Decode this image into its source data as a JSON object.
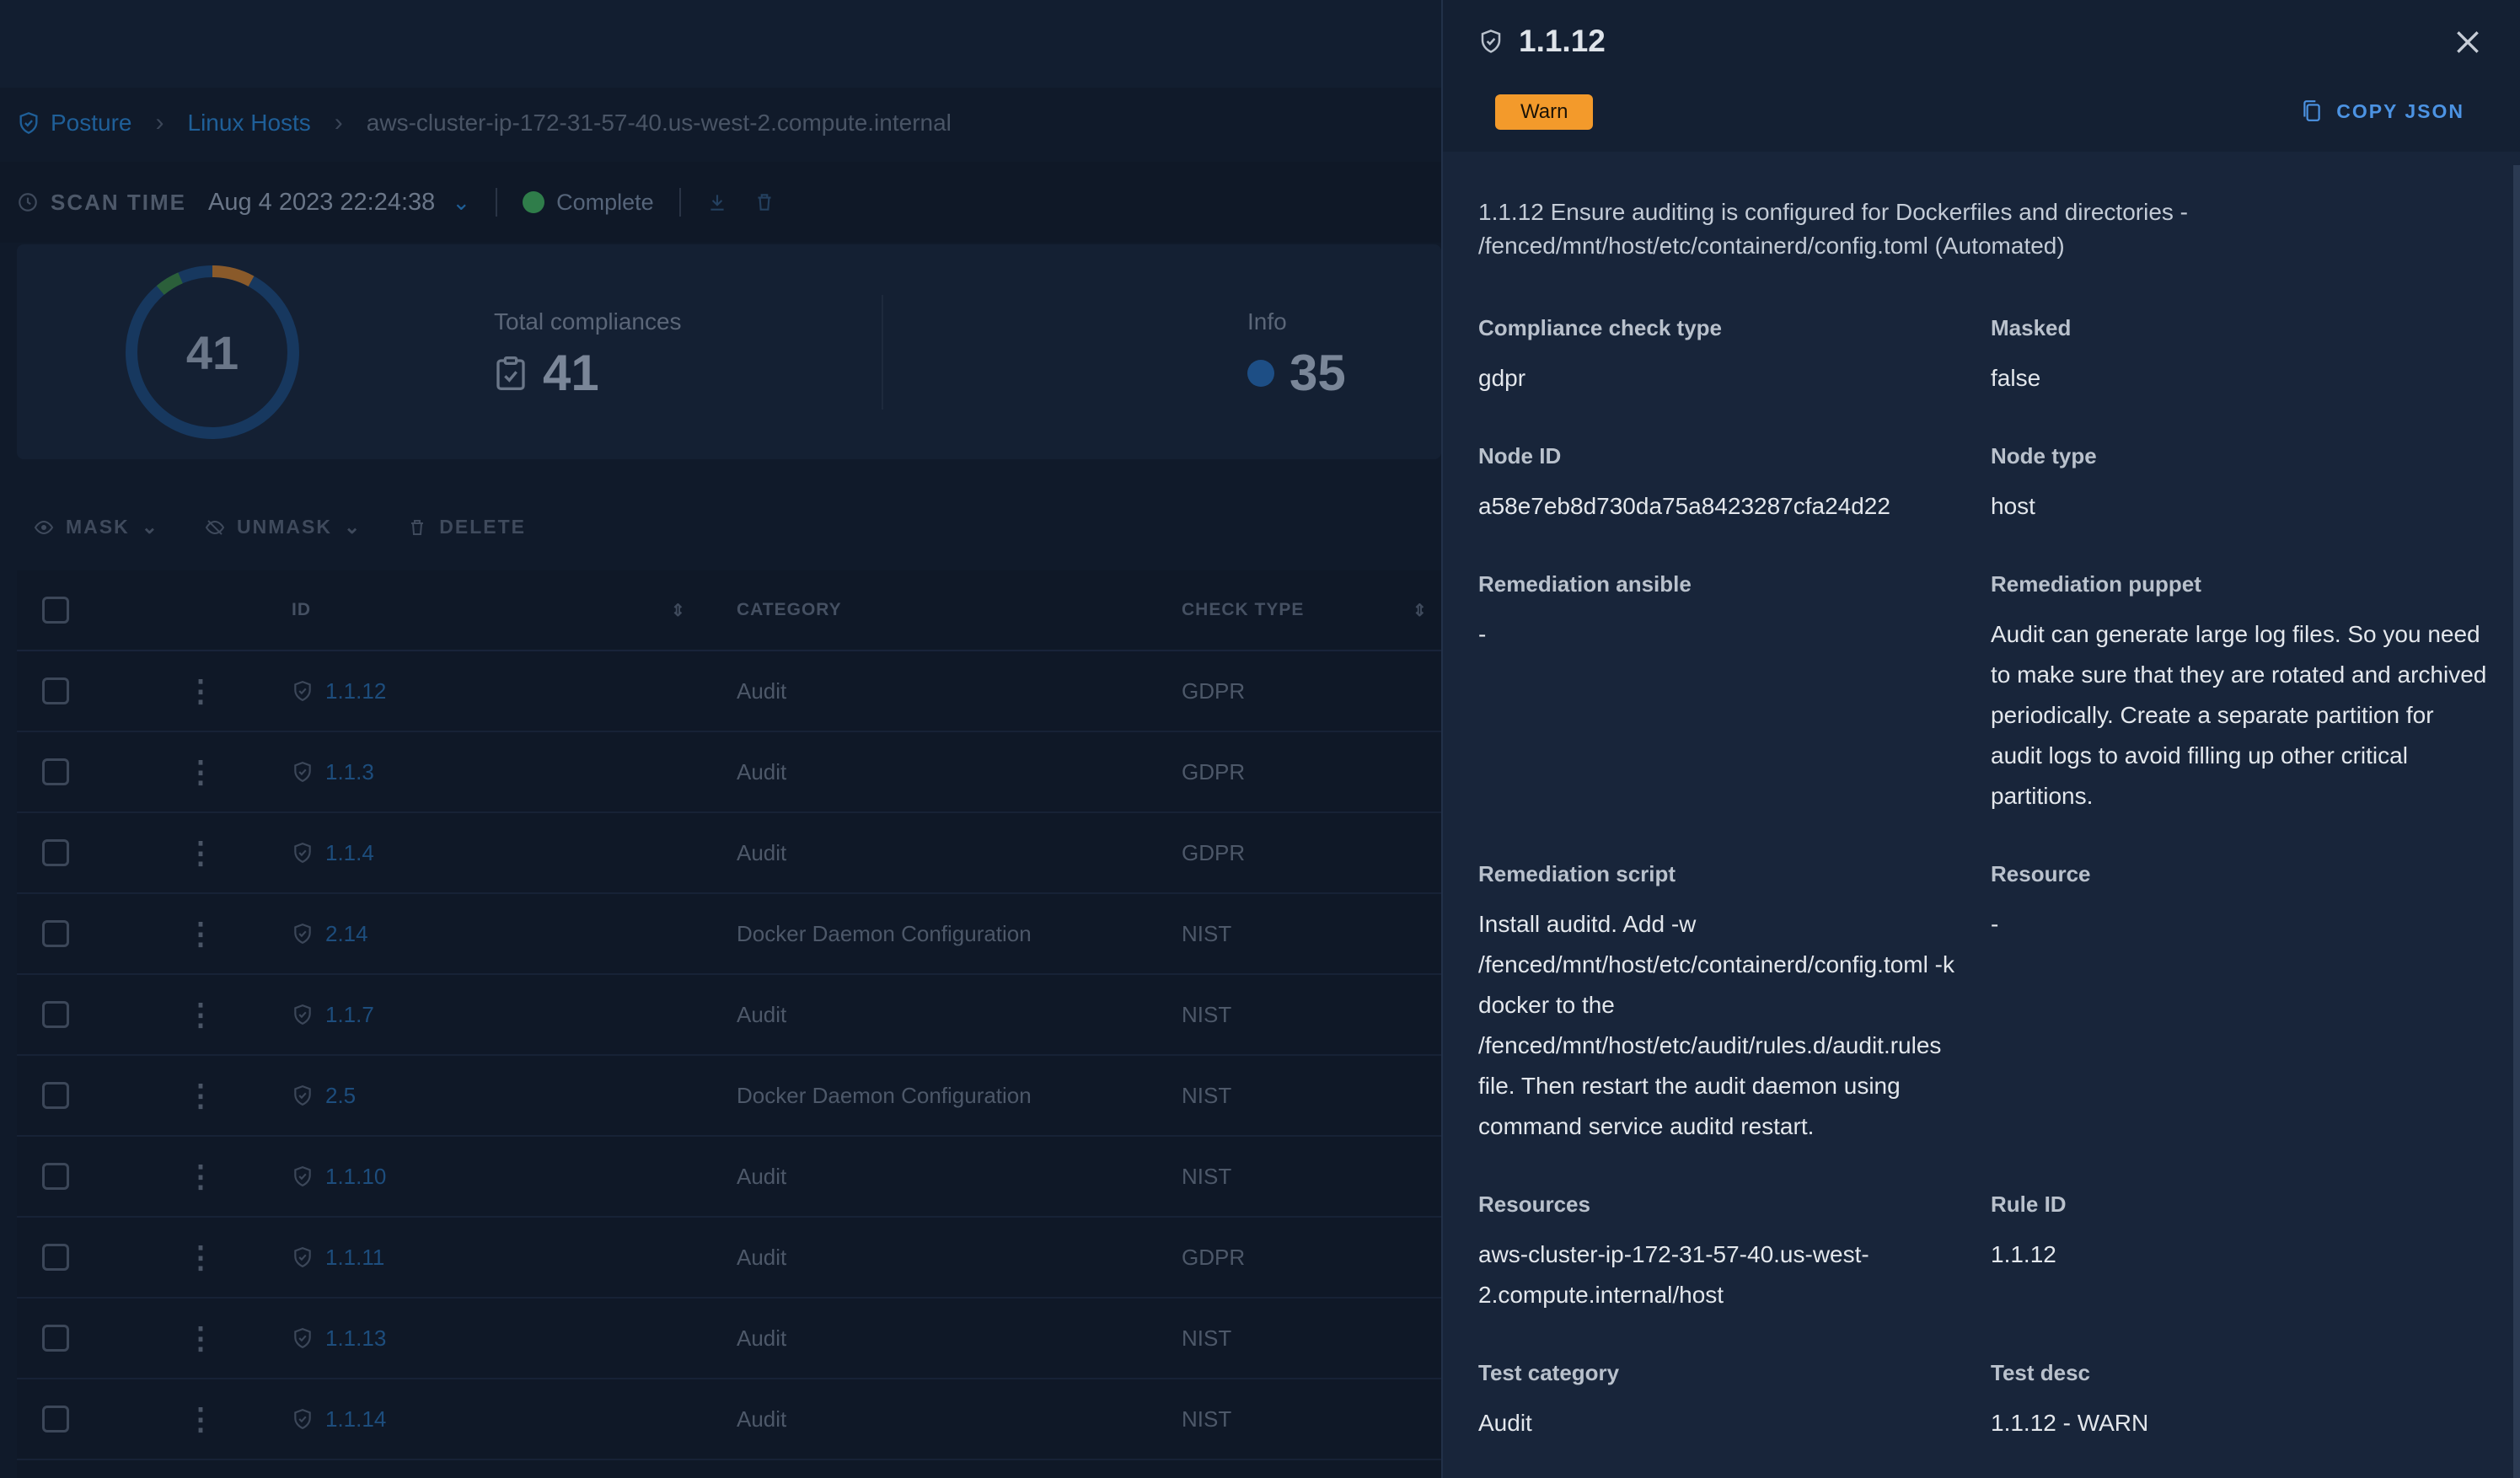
{
  "breadcrumb": {
    "items": [
      "Posture",
      "Linux Hosts",
      "aws-cluster-ip-172-31-57-40.us-west-2.compute.internal"
    ]
  },
  "scan": {
    "label": "SCAN TIME",
    "value": "Aug 4 2023 22:24:38",
    "status": "Complete"
  },
  "summary": {
    "donut_total": "41",
    "total_label": "Total compliances",
    "total_value": "41",
    "info_label": "Info",
    "info_value": "35",
    "colors": {
      "donut_base": "#17385f",
      "warn": "#8a5a2a",
      "pass": "#2b5f3a"
    }
  },
  "actions": {
    "mask": "MASK",
    "unmask": "UNMASK",
    "delete": "DELETE"
  },
  "table": {
    "headers": {
      "id": "ID",
      "category": "CATEGORY",
      "check_type": "CHECK TYPE"
    },
    "rows": [
      {
        "id": "1.1.12",
        "category": "Audit",
        "check_type": "GDPR"
      },
      {
        "id": "1.1.3",
        "category": "Audit",
        "check_type": "GDPR"
      },
      {
        "id": "1.1.4",
        "category": "Audit",
        "check_type": "GDPR"
      },
      {
        "id": "2.14",
        "category": "Docker Daemon Configuration",
        "check_type": "NIST"
      },
      {
        "id": "1.1.7",
        "category": "Audit",
        "check_type": "NIST"
      },
      {
        "id": "2.5",
        "category": "Docker Daemon Configuration",
        "check_type": "NIST"
      },
      {
        "id": "1.1.10",
        "category": "Audit",
        "check_type": "NIST"
      },
      {
        "id": "1.1.11",
        "category": "Audit",
        "check_type": "GDPR"
      },
      {
        "id": "1.1.13",
        "category": "Audit",
        "check_type": "NIST"
      },
      {
        "id": "1.1.14",
        "category": "Audit",
        "check_type": "NIST"
      }
    ]
  },
  "drawer": {
    "title": "1.1.12",
    "status_badge": "Warn",
    "status_color": "#f39a2b",
    "copy_label": "COPY JSON",
    "description": "1.1.12 Ensure auditing is configured for Dockerfiles and directories - /fenced/mnt/host/etc/containerd/config.toml (Automated)",
    "fields": {
      "compliance_check_type": {
        "label": "Compliance check type",
        "value": "gdpr"
      },
      "masked": {
        "label": "Masked",
        "value": "false"
      },
      "node_id": {
        "label": "Node ID",
        "value": "a58e7eb8d730da75a8423287cfa24d22"
      },
      "node_type": {
        "label": "Node type",
        "value": "host"
      },
      "remediation_ansible": {
        "label": "Remediation ansible",
        "value": "-"
      },
      "remediation_puppet": {
        "label": "Remediation puppet",
        "value": "Audit can generate large log files. So you need to make sure that they are rotated and archived periodically. Create a separate partition for audit logs to avoid filling up other critical partitions."
      },
      "remediation_script": {
        "label": "Remediation script",
        "value": "Install auditd. Add -w /fenced/mnt/host/etc/containerd/config.toml -k docker to the /fenced/mnt/host/etc/audit/rules.d/audit.rules file. Then restart the audit daemon using command service auditd restart."
      },
      "resource": {
        "label": "Resource",
        "value": "-"
      },
      "resources": {
        "label": "Resources",
        "value": "aws-cluster-ip-172-31-57-40.us-west-2.compute.internal/host"
      },
      "rule_id": {
        "label": "Rule ID",
        "value": "1.1.12"
      },
      "test_category": {
        "label": "Test category",
        "value": "Audit"
      },
      "test_desc": {
        "label": "Test desc",
        "value": "1.1.12 - WARN"
      }
    }
  }
}
